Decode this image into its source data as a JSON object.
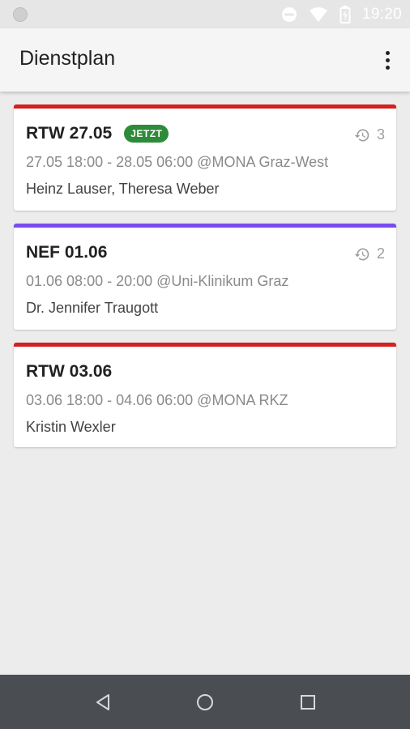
{
  "status_bar": {
    "time": "19:20",
    "icons": [
      "notification-dot-icon",
      "do-not-disturb-icon",
      "wifi-icon",
      "battery-icon"
    ]
  },
  "app_bar": {
    "title": "Dienstplan",
    "menu_icon": "more-vert-icon"
  },
  "shifts": [
    {
      "title": "RTW 27.05",
      "badge": "JETZT",
      "history_count": "3",
      "time_location": "27.05 18:00 - 28.05 06:00 @MONA Graz-West",
      "people": "Heinz Lauser, Theresa Weber",
      "accent_color": "#d32020"
    },
    {
      "title": "NEF 01.06",
      "history_count": "2",
      "time_location": "01.06 08:00 - 20:00 @Uni-Klinikum Graz",
      "people": "Dr. Jennifer Traugott",
      "accent_color": "#7a4cf0"
    },
    {
      "title": "RTW 03.06",
      "time_location": "03.06 18:00 - 04.06 06:00 @MONA RKZ",
      "people": "Kristin Wexler",
      "accent_color": "#d32020"
    }
  ],
  "nav_bar": {
    "buttons": [
      "back-icon",
      "home-icon",
      "recents-icon"
    ]
  }
}
